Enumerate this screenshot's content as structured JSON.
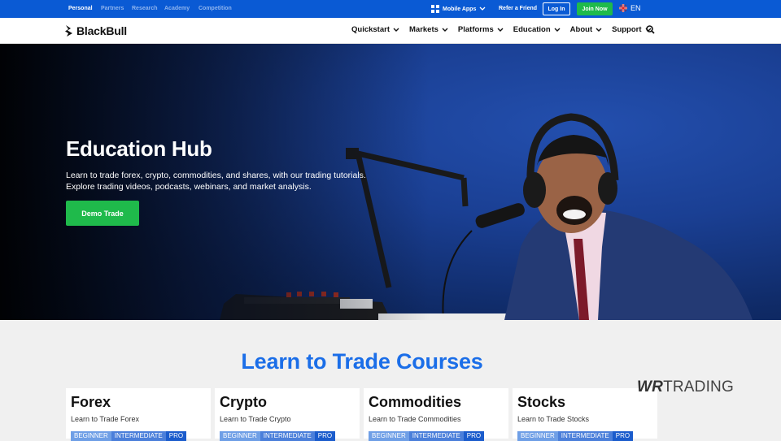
{
  "topbar": {
    "segments": [
      "Personal",
      "Partners",
      "Research",
      "Academy",
      "Competition"
    ],
    "mobile_apps": "Mobile Apps",
    "refer": "Refer a Friend",
    "login": "Log In",
    "join": "Join Now",
    "language": "EN"
  },
  "nav": {
    "brand": "BlackBull",
    "items": [
      "Quickstart",
      "Markets",
      "Platforms",
      "Education",
      "About",
      "Support"
    ]
  },
  "hero": {
    "title": "Education Hub",
    "subtitle_line1": "Learn to trade forex, crypto, commodities, and shares, with our trading tutorials.",
    "subtitle_line2": "Explore trading videos, podcasts, webinars, and market analysis.",
    "cta": "Demo Trade"
  },
  "courses": {
    "title": "Learn to Trade Courses",
    "cards": [
      {
        "title": "Forex",
        "subtitle": "Learn to Trade Forex"
      },
      {
        "title": "Crypto",
        "subtitle": "Learn to Trade Crypto"
      },
      {
        "title": "Commodities",
        "subtitle": "Learn to Trade Commodities"
      },
      {
        "title": "Stocks",
        "subtitle": "Learn to Trade Stocks"
      }
    ],
    "levels": [
      "BEGINNER",
      "INTERMEDIATE",
      "PRO"
    ]
  },
  "watermark": {
    "bold": "WR",
    "rest": "TRADING"
  },
  "colors": {
    "topbar": "#0a5ad4",
    "green": "#1fba4b",
    "accent_blue": "#1b6ee8"
  }
}
